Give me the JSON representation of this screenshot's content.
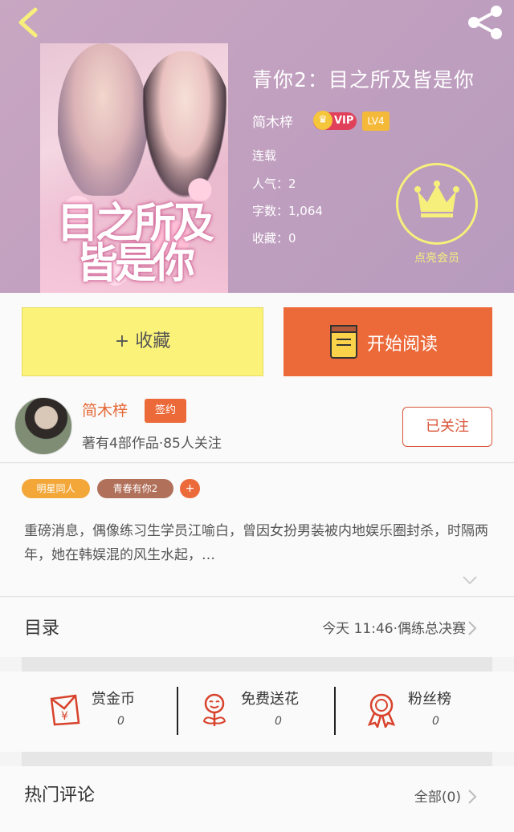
{
  "header": {
    "book_title": "青你2：目之所及皆是你",
    "author": "简木梓",
    "vip_label": "VIP",
    "level_label": "LV4",
    "status": "连载",
    "popularity": "人气：2",
    "word_count": "字数：1,064",
    "favorites": "收藏：0",
    "member_label": "点亮会员",
    "cover_title": "目之所及 皆是你"
  },
  "actions": {
    "favorite_label": "+ 收藏",
    "read_label": "开始阅读"
  },
  "author_info": {
    "name": "简木梓",
    "signed_label": "签约",
    "meta": "著有4部作品·85人关注",
    "follow_label": "已关注"
  },
  "tags": [
    "明星同人",
    "青春有你2",
    "+"
  ],
  "description": "重磅消息，偶像练习生学员江喻白，曾因女扮男装被内地娱乐圈封杀，时隔两年，她在韩娱混的风生水起，…",
  "catalog": {
    "title": "目录",
    "latest": "今天 11:46·偶练总决赛"
  },
  "stats": [
    {
      "label": "赏金币",
      "value": "0",
      "icon": "red-envelope-icon"
    },
    {
      "label": "免费送花",
      "value": "0",
      "icon": "flower-icon"
    },
    {
      "label": "粉丝榜",
      "value": "0",
      "icon": "medal-icon"
    }
  ],
  "comments": {
    "title": "热门评论",
    "all_label": "全部(0)"
  },
  "colors": {
    "header_bg": "#c2a0bf",
    "accent_orange": "#ec6a3a",
    "favorite_yellow": "#fbf27a",
    "member_yellow": "#f6ef7b"
  }
}
